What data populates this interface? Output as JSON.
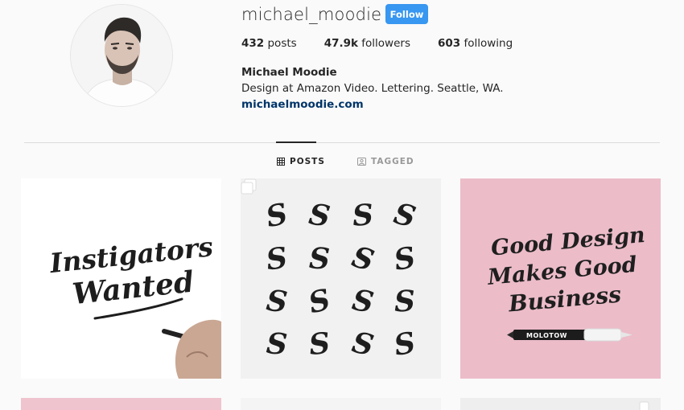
{
  "profile": {
    "username": "michael_moodie",
    "follow_label": "Follow",
    "stats": [
      {
        "count": "432",
        "label": "posts"
      },
      {
        "count": "47.9k",
        "label": "followers"
      },
      {
        "count": "603",
        "label": "following"
      }
    ],
    "full_name": "Michael Moodie",
    "bio": "Design at Amazon Video. Lettering. Seattle, WA.",
    "website": "michaelmoodie.com"
  },
  "tabs": [
    {
      "label": "POSTS",
      "icon": "grid-icon",
      "active": true
    },
    {
      "label": "TAGGED",
      "icon": "tag-icon",
      "active": false
    }
  ],
  "posts": [
    {
      "lettering": [
        "Instigators",
        "Wanted"
      ],
      "background": "#ffffff"
    },
    {
      "lettering": [
        "S"
      ],
      "background": "#f1f1f1",
      "multi": true
    },
    {
      "lettering": [
        "Good Design",
        "Makes Good",
        "Business"
      ],
      "marker_label": "MOLOTOW",
      "background": "#ecbcc9"
    }
  ],
  "colors": {
    "follow_button": "#3897f0",
    "link": "#003569",
    "divider": "#dbdbdb"
  }
}
